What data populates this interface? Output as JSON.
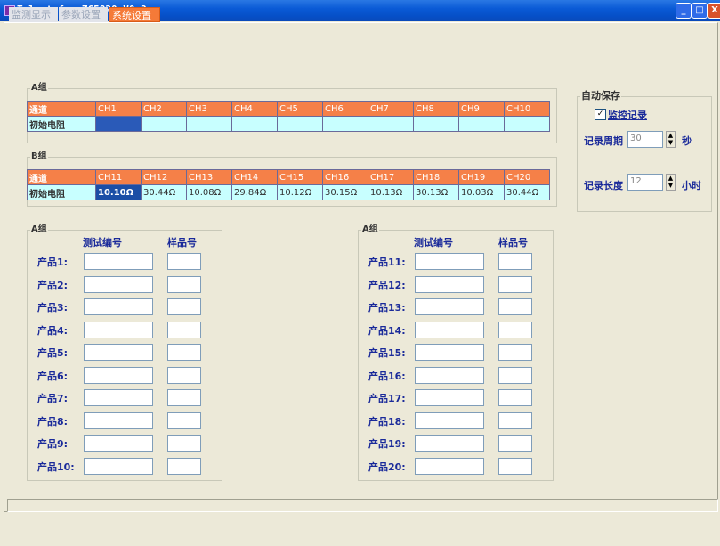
{
  "window": {
    "title": "Telnet for ZC5820 V0.2",
    "min_label": "_",
    "max_label": "□",
    "close_label": "X"
  },
  "tabs": [
    "监测显示",
    "参数设置",
    "系统设置"
  ],
  "groupA_table": {
    "label": "A组",
    "header_label": "通道",
    "row_label": "初始电阻",
    "channels": [
      "CH1",
      "CH2",
      "CH3",
      "CH4",
      "CH5",
      "CH6",
      "CH7",
      "CH8",
      "CH9",
      "CH10"
    ],
    "values": [
      "",
      "",
      "",
      "",
      "",
      "",
      "",
      "",
      "",
      ""
    ]
  },
  "groupB_table": {
    "label": "B组",
    "header_label": "通道",
    "row_label": "初始电阻",
    "channels": [
      "CH11",
      "CH12",
      "CH13",
      "CH14",
      "CH15",
      "CH16",
      "CH17",
      "CH18",
      "CH19",
      "CH20"
    ],
    "values": [
      "10.10Ω",
      "30.44Ω",
      "10.08Ω",
      "29.84Ω",
      "10.12Ω",
      "30.15Ω",
      "10.13Ω",
      "30.13Ω",
      "10.03Ω",
      "30.44Ω"
    ]
  },
  "autosave": {
    "label": "自动保存",
    "monitor_label": "监控记录",
    "monitor_checked": true,
    "check_mark": "✓",
    "period_label": "记录周期",
    "period_value": "30",
    "period_unit": "秒",
    "length_label": "记录长度",
    "length_value": "12",
    "length_unit": "小时",
    "spin_up": "▲",
    "spin_down": "▼"
  },
  "left_products": {
    "label": "A组",
    "col_test": "测试编号",
    "col_sample": "样品号",
    "items": [
      "产品1:",
      "产品2:",
      "产品3:",
      "产品4:",
      "产品5:",
      "产品6:",
      "产品7:",
      "产品8:",
      "产品9:",
      "产品10:"
    ]
  },
  "right_products": {
    "label": "A组",
    "col_test": "测试编号",
    "col_sample": "样品号",
    "items": [
      "产品11:",
      "产品12:",
      "产品13:",
      "产品14:",
      "产品15:",
      "产品16:",
      "产品17:",
      "产品18:",
      "产品19:",
      "产品20:"
    ]
  }
}
